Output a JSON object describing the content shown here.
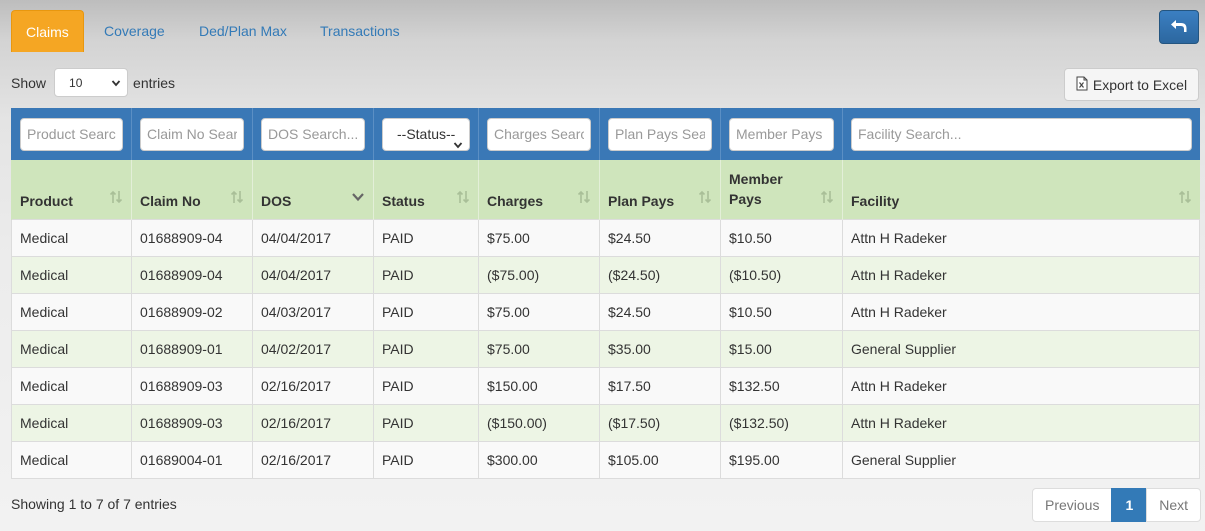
{
  "tabs": [
    {
      "label": "Claims",
      "active": true
    },
    {
      "label": "Coverage",
      "active": false
    },
    {
      "label": "Ded/Plan Max",
      "active": false
    },
    {
      "label": "Transactions",
      "active": false
    }
  ],
  "back_button": {
    "icon": "back-arrow-icon"
  },
  "length": {
    "prefix": "Show",
    "value": "10",
    "suffix": "entries"
  },
  "export_button": {
    "label": "Export to Excel",
    "icon": "excel-file-icon"
  },
  "filters": {
    "product": "Product Search...",
    "claim_no": "Claim No Search...",
    "dos": "DOS Search...",
    "status": "--Status--",
    "charges": "Charges Search...",
    "plan_pays": "Plan Pays Search...",
    "member_pays": "Member Pays",
    "facility": "Facility Search..."
  },
  "columns": [
    "Product",
    "Claim No",
    "DOS",
    "Status",
    "Charges",
    "Plan Pays",
    "Member Pays",
    "Facility"
  ],
  "rows": [
    [
      "Medical",
      "01688909-04",
      "04/04/2017",
      "PAID",
      "$75.00",
      "$24.50",
      "$10.50",
      "Attn H Radeker"
    ],
    [
      "Medical",
      "01688909-04",
      "04/04/2017",
      "PAID",
      "($75.00)",
      "($24.50)",
      "($10.50)",
      "Attn H Radeker"
    ],
    [
      "Medical",
      "01688909-02",
      "04/03/2017",
      "PAID",
      "$75.00",
      "$24.50",
      "$10.50",
      "Attn H Radeker"
    ],
    [
      "Medical",
      "01688909-01",
      "04/02/2017",
      "PAID",
      "$75.00",
      "$35.00",
      "$15.00",
      "General Supplier"
    ],
    [
      "Medical",
      "01688909-03",
      "02/16/2017",
      "PAID",
      "$150.00",
      "$17.50",
      "$132.50",
      "Attn H Radeker"
    ],
    [
      "Medical",
      "01688909-03",
      "02/16/2017",
      "PAID",
      "($150.00)",
      "($17.50)",
      "($132.50)",
      "Attn H Radeker"
    ],
    [
      "Medical",
      "01689004-01",
      "02/16/2017",
      "PAID",
      "$300.00",
      "$105.00",
      "$195.00",
      "General Supplier"
    ]
  ],
  "info": "Showing 1 to 7 of 7 entries",
  "pagination": {
    "previous": "Previous",
    "current": "1",
    "next": "Next"
  },
  "colors": {
    "active_tab": "#f5a623",
    "filter_bar": "#3a78b6",
    "header_bar": "#cfe5bc",
    "link": "#337ab7"
  }
}
